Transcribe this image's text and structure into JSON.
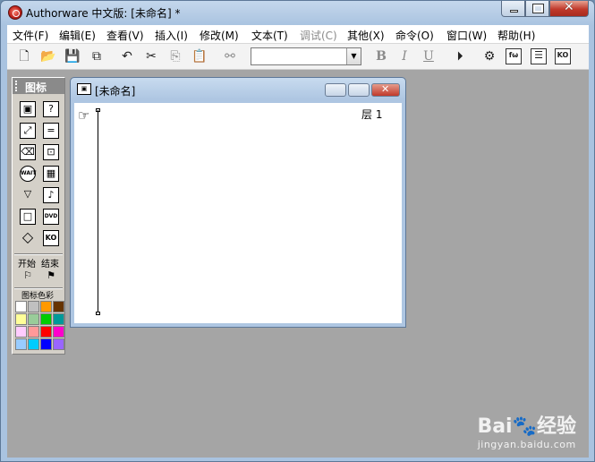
{
  "window": {
    "title": "Authorware 中文版: [未命名] *",
    "buttons": {
      "minimize": "minimize",
      "maximize": "maximize",
      "close": "close"
    }
  },
  "menu": [
    {
      "label": "文件(F)",
      "enabled": true
    },
    {
      "label": "编辑(E)",
      "enabled": true
    },
    {
      "label": "查看(V)",
      "enabled": true
    },
    {
      "label": "插入(I)",
      "enabled": true
    },
    {
      "label": "修改(M)",
      "enabled": true
    },
    {
      "label": "文本(T)",
      "enabled": true
    },
    {
      "label": "调试(C)",
      "enabled": false
    },
    {
      "label": "其他(X)",
      "enabled": true
    },
    {
      "label": "命令(O)",
      "enabled": true
    },
    {
      "label": "窗口(W)",
      "enabled": true
    },
    {
      "label": "帮助(H)",
      "enabled": true
    }
  ],
  "toolbar": {
    "icons": [
      "new-file-icon",
      "open-folder-icon",
      "save-all-icon",
      "import-icon",
      "undo-icon",
      "cut-icon",
      "copy-icon",
      "paste-icon",
      "find-icon",
      "bold-icon",
      "italic-icon",
      "underline-icon",
      "run-icon",
      "control-panel-icon",
      "functions-icon",
      "variables-icon",
      "knowledge-objects-icon"
    ],
    "bold": "B",
    "italic": "I",
    "underline": "U",
    "functions": "fω",
    "knowledge": "KO",
    "style_value": ""
  },
  "icon_palette": {
    "title": "图标",
    "start_label": "开始",
    "end_label": "结束",
    "color_label": "图标色彩",
    "icons": [
      "display-icon",
      "interaction-icon",
      "motion-icon",
      "calculation-icon",
      "erase-icon",
      "map-icon",
      "wait-icon",
      "digital-movie-icon",
      "navigate-icon",
      "sound-icon",
      "framework-icon",
      "dvd-icon",
      "decision-icon",
      "knowledge-object-icon"
    ],
    "wait_text": "WAIT",
    "dvd_text": "DVD",
    "ko_text": "KO",
    "colors": [
      "#ffffff",
      "#c0c0c0",
      "#ff9900",
      "#663300",
      "#ffff99",
      "#99cc99",
      "#00cc00",
      "#009999",
      "#ffccff",
      "#ff9999",
      "#ff0000",
      "#ff00cc",
      "#99ccff",
      "#00ccff",
      "#0000ff",
      "#9966ff"
    ]
  },
  "document": {
    "title": "[未命名]",
    "layer_label": "层 1"
  },
  "watermark": {
    "logo": "Bai🐾经验",
    "url": "jingyan.baidu.com"
  }
}
